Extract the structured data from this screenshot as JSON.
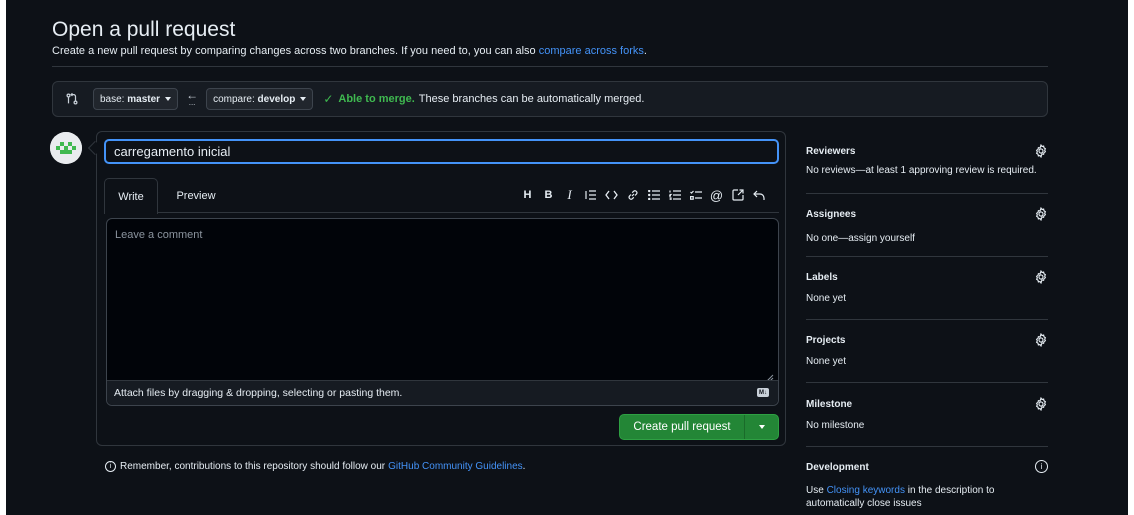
{
  "page": {
    "title": "Open a pull request",
    "subtitle_prefix": "Create a new pull request by comparing changes across two branches. If you need to, you can also",
    "subtitle_link": "compare across forks",
    "subtitle_suffix": "."
  },
  "compare": {
    "base_prefix": "base:",
    "base_branch": "master",
    "compare_prefix": "compare:",
    "compare_branch": "develop",
    "merge_status": "Able to merge.",
    "merge_message": "These branches can be automatically merged."
  },
  "editor": {
    "title_value": "carregamento inicial",
    "tabs": [
      {
        "label": "Write"
      },
      {
        "label": "Preview"
      }
    ],
    "toolbar": [
      {
        "icon": "heading-icon",
        "glyph": "H"
      },
      {
        "icon": "bold-icon",
        "glyph": "B"
      },
      {
        "icon": "italic-icon",
        "glyph": "I"
      },
      {
        "icon": "quote-icon",
        "glyph": "⁼"
      },
      {
        "icon": "code-icon",
        "glyph": "<>"
      },
      {
        "icon": "link-icon",
        "glyph": "🔗"
      },
      {
        "icon": "unordered-list-icon",
        "glyph": "☰"
      },
      {
        "icon": "ordered-list-icon",
        "glyph": "☷"
      },
      {
        "icon": "task-list-icon",
        "glyph": "☑"
      },
      {
        "icon": "mention-icon",
        "glyph": "@"
      },
      {
        "icon": "reference-icon",
        "glyph": "↗"
      },
      {
        "icon": "undo-icon",
        "glyph": "↶"
      }
    ],
    "comment_placeholder": "Leave a comment",
    "attach_text": "Attach files by dragging & dropping, selecting or pasting them.",
    "markdown_badge": "M↓",
    "create_button": "Create pull request"
  },
  "reminder": {
    "text": "Remember, contributions to this repository should follow our",
    "link": "GitHub Community Guidelines",
    "suffix": "."
  },
  "sidebar": {
    "reviewers": {
      "heading": "Reviewers",
      "value": "No reviews—at least 1 approving review is required."
    },
    "assignees": {
      "heading": "Assignees",
      "value": "No one—assign yourself"
    },
    "labels": {
      "heading": "Labels",
      "value": "None yet"
    },
    "projects": {
      "heading": "Projects",
      "value": "None yet"
    },
    "milestone": {
      "heading": "Milestone",
      "value": "No milestone"
    },
    "development": {
      "heading": "Development",
      "value_prefix": "Use",
      "value_link": "Closing keywords",
      "value_suffix_line1": "in the description to",
      "value_line2": "automatically close issues"
    }
  },
  "colors": {
    "background": "#0d1117",
    "accent_blue": "#4493f8",
    "success_green": "#3fb950",
    "button_green": "#238636"
  }
}
